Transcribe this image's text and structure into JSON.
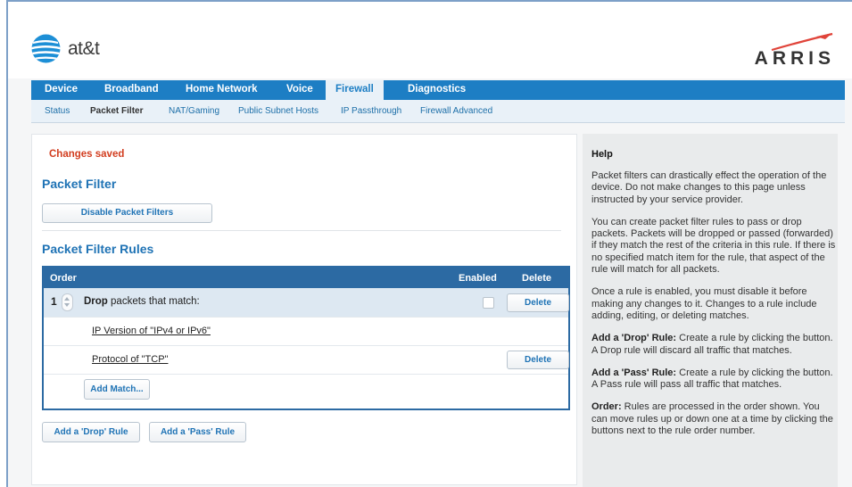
{
  "brand": {
    "left_logo_text": "at&t",
    "right_logo_text": "ARRIS"
  },
  "nav": {
    "tabs": [
      {
        "label": "Device"
      },
      {
        "label": "Broadband"
      },
      {
        "label": "Home Network"
      },
      {
        "label": "Voice"
      },
      {
        "label": "Firewall",
        "active": true
      },
      {
        "label": "Diagnostics"
      }
    ],
    "subtabs": [
      {
        "label": "Status"
      },
      {
        "label": "Packet Filter",
        "active": true
      },
      {
        "label": "NAT/Gaming"
      },
      {
        "label": "Public Subnet Hosts"
      },
      {
        "label": "IP Passthrough"
      },
      {
        "label": "Firewall Advanced"
      }
    ]
  },
  "main": {
    "status": "Changes saved",
    "packet_filter_title": "Packet Filter",
    "disable_button": "Disable Packet Filters",
    "rules_title": "Packet Filter Rules",
    "table": {
      "headers": {
        "order": "Order",
        "enabled": "Enabled",
        "delete": "Delete"
      },
      "rule": {
        "order": "1",
        "action": "Drop",
        "desc": " packets that match:",
        "enabled": false,
        "delete": "Delete"
      },
      "matches": [
        {
          "label": "IP Version of \"IPv4 or IPv6\"",
          "delete": ""
        },
        {
          "label": "Protocol of \"TCP\"",
          "delete": "Delete"
        }
      ],
      "add_match": "Add Match..."
    },
    "add_drop": "Add a 'Drop' Rule",
    "add_pass": "Add a 'Pass' Rule"
  },
  "help": {
    "title": "Help",
    "p1": "Packet filters can drastically effect the operation of the device. Do not make changes to this page unless instructed by your service provider.",
    "p2": "You can create packet filter rules to pass or drop packets. Packets will be dropped or passed (forwarded) if they match the rest of the criteria in this rule. If there is no specified match item for the rule, that aspect of the rule will match for all packets.",
    "p3": "Once a rule is enabled, you must disable it before making any changes to it. Changes to a rule include adding, editing, or deleting matches.",
    "p4_b": "Add a 'Drop' Rule:",
    "p4": " Create a rule by clicking the button. A Drop rule will discard all traffic that matches.",
    "p5_b": "Add a 'Pass' Rule:",
    "p5": " Create a rule by clicking the button. A Pass rule will pass all traffic that matches.",
    "p6_b": "Order:",
    "p6": " Rules are processed in the order shown. You can move rules up or down one at a time by clicking the buttons next to the rule order number."
  },
  "colors": {
    "nav_bg": "#1d7ec4",
    "table_header": "#2c6aa3",
    "status_red": "#d23d1f",
    "link_blue": "#1f73b5"
  }
}
